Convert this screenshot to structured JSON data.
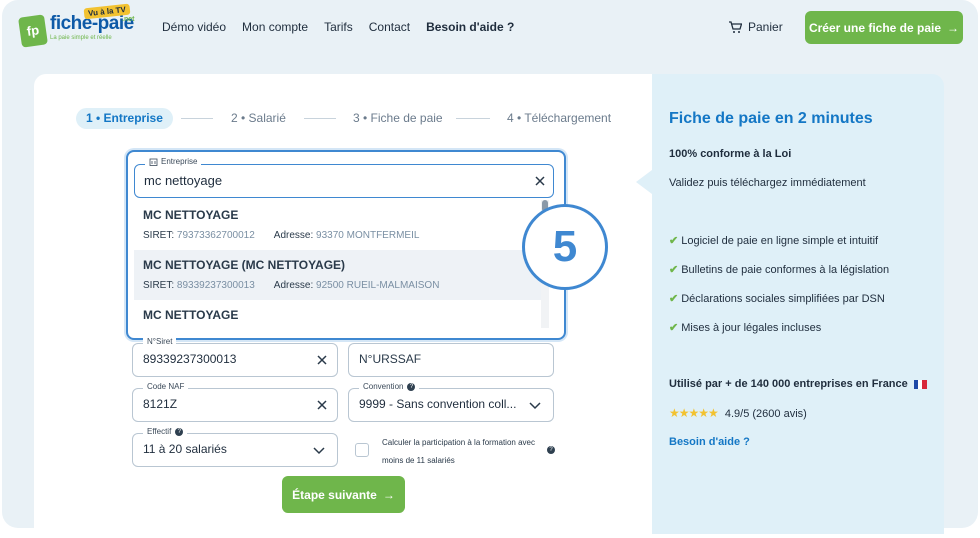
{
  "header": {
    "logo": {
      "brand": "fiche-paie",
      "badge": "fp",
      "tv_tag": "Vu à la TV",
      "net": ".net",
      "tagline": "La paie simple et réelle"
    },
    "nav": [
      "Démo vidéo",
      "Mon compte",
      "Tarifs",
      "Contact",
      "Besoin d'aide ?"
    ],
    "cart_label": "Panier",
    "cta_label": "Créer une fiche de paie",
    "colors": {
      "accent_green": "#6fb64b",
      "accent_blue": "#1477c5"
    }
  },
  "stepper": {
    "steps": [
      "1 • Entreprise",
      "2 • Salarié",
      "3 • Fiche de paie",
      "4 • Téléchargement"
    ],
    "active_index": 0
  },
  "form": {
    "entreprise": {
      "label": "Entreprise",
      "value": "mc nettoyage",
      "suggestions": [
        {
          "name": "MC NETTOYAGE",
          "siret_label": "SIRET:",
          "siret": "79373362700012",
          "address_label": "Adresse:",
          "address": "93370 MONTFERMEIL"
        },
        {
          "name": "MC NETTOYAGE (MC NETTOYAGE)",
          "siret_label": "SIRET:",
          "siret": "89339237300013",
          "address_label": "Adresse:",
          "address": "92500 RUEIL-MALMAISON"
        },
        {
          "name": "MC NETTOYAGE"
        }
      ]
    },
    "siret": {
      "label": "N°Siret",
      "value": "89339237300013"
    },
    "urssaf": {
      "placeholder": "N°URSSAF"
    },
    "naf": {
      "label": "Code NAF",
      "value": "8121Z"
    },
    "convention": {
      "label": "Convention",
      "value": "9999 - Sans convention coll..."
    },
    "effectif": {
      "label": "Effectif",
      "value": "11 à 20 salariés"
    },
    "checkbox_label": "Calculer la participation à la formation avec moins de 11 salariés",
    "next_label": "Étape suivante"
  },
  "overlay_badge": "5",
  "sidebar": {
    "title": "Fiche de paie en 2 minutes",
    "subtitle": "100% conforme à la Loi",
    "subtitle2": "Validez puis téléchargez immédiatement",
    "features": [
      "Logiciel de paie en ligne simple et intuitif",
      "Bulletins de paie conformes à la législation",
      "Déclarations sociales simplifiées par DSN",
      "Mises à jour légales incluses"
    ],
    "used_by": "Utilisé par + de 140 000 entreprises en France",
    "rating": "4.9/5 (2600 avis)",
    "stars": 5,
    "help": "Besoin d'aide ?"
  }
}
